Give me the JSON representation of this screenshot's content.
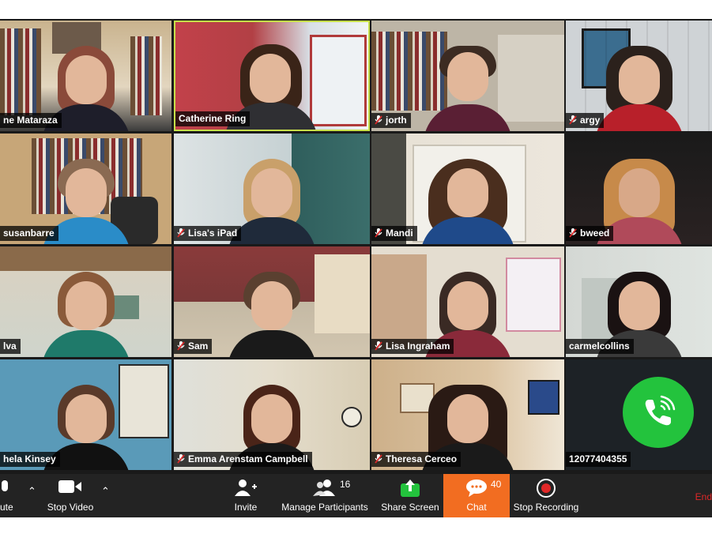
{
  "colors": {
    "active_border": "#c8e04a",
    "chat_accent": "#f26d21",
    "call_green": "#23c33d",
    "end_red": "#e02828",
    "toolbar_bg": "#232323"
  },
  "participants": [
    {
      "name": "ne Mataraza",
      "muted": false
    },
    {
      "name": "Catherine Ring",
      "muted": false,
      "active": true
    },
    {
      "name": "jorth",
      "muted": true
    },
    {
      "name": "argy",
      "muted": true
    },
    {
      "name": "susanbarre",
      "muted": false
    },
    {
      "name": "Lisa's iPad",
      "muted": true
    },
    {
      "name": "Mandi",
      "muted": true
    },
    {
      "name": "bweed",
      "muted": true
    },
    {
      "name": "lva",
      "muted": false
    },
    {
      "name": "Sam",
      "muted": true
    },
    {
      "name": "Lisa Ingraham",
      "muted": true
    },
    {
      "name": "carmelcollins",
      "muted": false
    },
    {
      "name": "hela Kinsey",
      "muted": false
    },
    {
      "name": "Emma Arenstam Campbell",
      "muted": true
    },
    {
      "name": "Theresa Cerceo",
      "muted": true
    },
    {
      "name": "12077404355",
      "muted": false,
      "phone": true,
      "icon": "phone-icon"
    }
  ],
  "toolbar": {
    "mute_label": "ute",
    "stop_video_label": "Stop Video",
    "invite_label": "Invite",
    "manage_participants_label": "Manage Participants",
    "participants_count": "16",
    "share_screen_label": "Share Screen",
    "chat_label": "Chat",
    "chat_count": "40",
    "stop_recording_label": "Stop Recording",
    "end_label": "End"
  }
}
